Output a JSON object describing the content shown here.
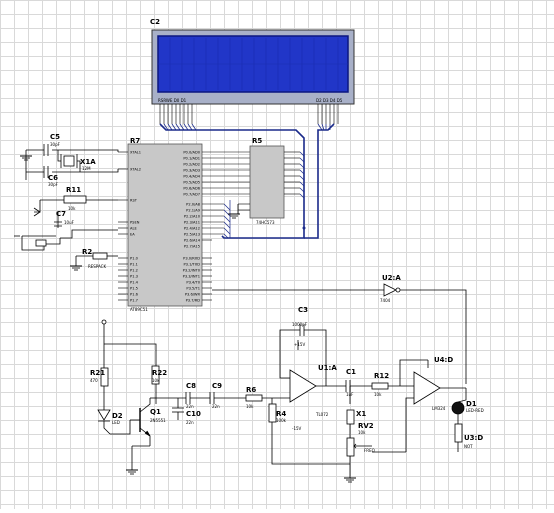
{
  "components": {
    "lcd": {
      "ref": "C2",
      "pins_left": "RSRWE D0 D1",
      "pins_right": "D2 D3 D4 D5"
    },
    "mcu": {
      "ref": "R7",
      "part": "AT89C51",
      "left_pins": [
        "XTAL1",
        "XTAL2",
        "RST",
        "PSEN",
        "ALE",
        "EA",
        "P1.0",
        "P1.1",
        "P1.2",
        "P1.3",
        "P1.4",
        "P1.5",
        "P1.6",
        "P1.7"
      ],
      "right_pins": [
        "P0.0/AD0",
        "P0.1/AD1",
        "P0.2/AD2",
        "P0.3/AD3",
        "P0.4/AD4",
        "P0.5/AD5",
        "P0.6/AD6",
        "P0.7/AD7",
        "P2.0/A8",
        "P2.1/A9",
        "P2.2/A10",
        "P2.3/A11",
        "P2.4/A12",
        "P2.5/A13",
        "P2.6/A14",
        "P2.7/A15",
        "P3.0/RXD",
        "P3.1/TXD",
        "P3.2/INT0",
        "P3.3/INT1",
        "P3.4/T0",
        "P3.5/T1",
        "P3.6/WR",
        "P3.7/RD"
      ]
    },
    "latch": {
      "ref": "R5",
      "part": "74HC573"
    },
    "crystal": {
      "ref": "X1A",
      "value": "12M"
    },
    "c5": {
      "ref": "C5",
      "value": "30pF"
    },
    "c6": {
      "ref": "C6",
      "value": "30pF"
    },
    "c7": {
      "ref": "C7",
      "value": "10uF"
    },
    "r11": {
      "ref": "R11",
      "value": "10k"
    },
    "r2": {
      "ref": "R2",
      "value": "RESPACK"
    },
    "u2a": {
      "ref": "U2:A",
      "part": "7404"
    },
    "c3": {
      "ref": "C3",
      "value": "1000pF"
    },
    "u1a": {
      "ref": "U1:A",
      "part": "TL072"
    },
    "u4d": {
      "ref": "U4:D",
      "part": "LM324"
    },
    "c1": {
      "ref": "C1",
      "value": "1uF"
    },
    "r12": {
      "ref": "R12",
      "value": "10k"
    },
    "r21": {
      "ref": "R21",
      "value": "470"
    },
    "r22": {
      "ref": "R22",
      "value": "10k"
    },
    "c8": {
      "ref": "C8",
      "value": "22n"
    },
    "c9": {
      "ref": "C9",
      "value": "22n"
    },
    "r6": {
      "ref": "R6",
      "value": "10k"
    },
    "r4": {
      "ref": "R4",
      "value": "100k"
    },
    "c10": {
      "ref": "C10",
      "value": "22n"
    },
    "q1": {
      "ref": "Q1",
      "part": "2N5551"
    },
    "d2": {
      "ref": "D2",
      "part": "LED"
    },
    "x1": {
      "ref": "X1",
      "part": "FREQ"
    },
    "rv2": {
      "ref": "RV2",
      "value": "10k"
    },
    "d1": {
      "ref": "D1",
      "part": "LED-RED"
    },
    "u3d": {
      "ref": "U3:D",
      "part": "NOT"
    },
    "supply": {
      "vcc": "+15V",
      "vee": "-15V"
    }
  },
  "colors": {
    "grid": "#d9d9d9",
    "lcd_screen": "#2136c8",
    "lcd_border": "#0a1680",
    "mcu_body": "#c8c8c8",
    "bus": "#1a2a8a",
    "wire": "#000000"
  }
}
